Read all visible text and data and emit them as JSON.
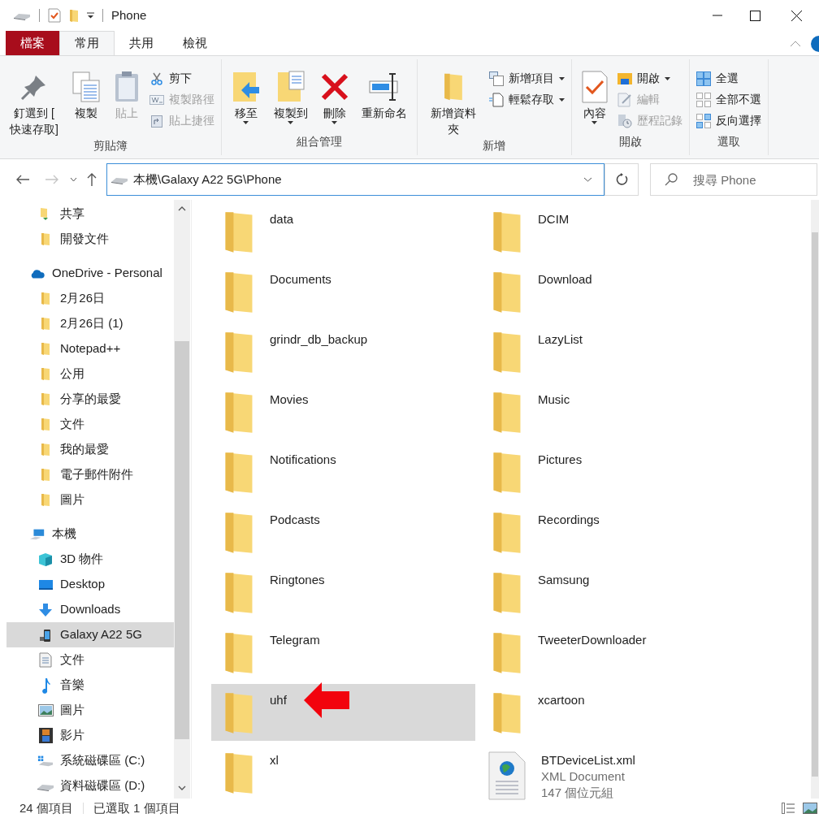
{
  "window": {
    "title": "Phone"
  },
  "tabs": [
    {
      "label": "檔案",
      "kind": "file",
      "selected": false
    },
    {
      "label": "常用",
      "kind": "tab",
      "selected": true
    },
    {
      "label": "共用",
      "kind": "tab",
      "selected": false
    },
    {
      "label": "檢視",
      "kind": "tab",
      "selected": false
    }
  ],
  "ribbon": {
    "groups": [
      {
        "label": "剪貼簿",
        "items": [
          {
            "kind": "large",
            "label": "釘選到 [\n快速存取]",
            "disabled": false,
            "dropdown": false
          },
          {
            "kind": "large",
            "label": "複製",
            "disabled": false,
            "dropdown": false
          },
          {
            "kind": "large",
            "label": "貼上",
            "disabled": true,
            "dropdown": false
          },
          {
            "kind": "small",
            "label": "剪下",
            "disabled": false,
            "dropdown": false
          },
          {
            "kind": "small",
            "label": "複製路徑",
            "disabled": true,
            "dropdown": false
          },
          {
            "kind": "small",
            "label": "貼上捷徑",
            "disabled": true,
            "dropdown": false
          }
        ]
      },
      {
        "label": "組合管理",
        "items": [
          {
            "kind": "large",
            "label": "移至",
            "disabled": false,
            "dropdown": true
          },
          {
            "kind": "large",
            "label": "複製到",
            "disabled": false,
            "dropdown": true
          },
          {
            "kind": "large",
            "label": "刪除",
            "disabled": false,
            "dropdown": true
          },
          {
            "kind": "large",
            "label": "重新命名",
            "disabled": false,
            "dropdown": false
          }
        ]
      },
      {
        "label": "新增",
        "items": [
          {
            "kind": "large",
            "label": "新增資料夾",
            "disabled": false,
            "dropdown": false
          },
          {
            "kind": "small",
            "label": "新增項目",
            "disabled": false,
            "dropdown": true
          },
          {
            "kind": "small",
            "label": "輕鬆存取",
            "disabled": false,
            "dropdown": true
          }
        ]
      },
      {
        "label": "開啟",
        "items": [
          {
            "kind": "large",
            "label": "內容",
            "disabled": false,
            "dropdown": true
          },
          {
            "kind": "small",
            "label": "開啟",
            "disabled": false,
            "dropdown": true
          },
          {
            "kind": "small",
            "label": "編輯",
            "disabled": true,
            "dropdown": false
          },
          {
            "kind": "small",
            "label": "歷程記錄",
            "disabled": true,
            "dropdown": false
          }
        ]
      },
      {
        "label": "選取",
        "items": [
          {
            "kind": "small",
            "label": "全選",
            "disabled": false,
            "dropdown": false
          },
          {
            "kind": "small",
            "label": "全部不選",
            "disabled": false,
            "dropdown": false
          },
          {
            "kind": "small",
            "label": "反向選擇",
            "disabled": false,
            "dropdown": false
          }
        ]
      }
    ]
  },
  "address_bar": {
    "path": "本機\\Galaxy A22 5G\\Phone"
  },
  "search": {
    "placeholder": "搜尋 Phone"
  },
  "navigation": {
    "items": [
      {
        "label": "共享",
        "kind": "shared",
        "selected": false
      },
      {
        "label": "開發文件",
        "kind": "folder",
        "selected": false
      }
    ],
    "sections": [
      {
        "label": "OneDrive - Personal",
        "kind": "cloud",
        "selected": false,
        "children": [
          {
            "label": "2月26日",
            "kind": "folder",
            "selected": false
          },
          {
            "label": "2月26日 (1)",
            "kind": "folder",
            "selected": false
          },
          {
            "label": "Notepad++",
            "kind": "folder",
            "selected": false
          },
          {
            "label": "公用",
            "kind": "folder",
            "selected": false
          },
          {
            "label": "分享的最愛",
            "kind": "folder",
            "selected": false
          },
          {
            "label": "文件",
            "kind": "folder",
            "selected": false
          },
          {
            "label": "我的最愛",
            "kind": "folder",
            "selected": false
          },
          {
            "label": "電子郵件附件",
            "kind": "folder",
            "selected": false
          },
          {
            "label": "圖片",
            "kind": "folder",
            "selected": false
          }
        ]
      },
      {
        "label": "本機",
        "kind": "pc",
        "selected": false,
        "children": [
          {
            "label": "3D 物件",
            "kind": "cube",
            "selected": false
          },
          {
            "label": "Desktop",
            "kind": "desktop",
            "selected": false
          },
          {
            "label": "Downloads",
            "kind": "download",
            "selected": false
          },
          {
            "label": "Galaxy A22 5G",
            "kind": "phone",
            "selected": true
          },
          {
            "label": "文件",
            "kind": "document",
            "selected": false
          },
          {
            "label": "音樂",
            "kind": "music",
            "selected": false
          },
          {
            "label": "圖片",
            "kind": "picture",
            "selected": false
          },
          {
            "label": "影片",
            "kind": "video",
            "selected": false
          },
          {
            "label": "系統磁碟區 (C:)",
            "kind": "system-drive",
            "selected": false
          },
          {
            "label": "資料磁碟區 (D:)",
            "kind": "drive",
            "selected": false
          }
        ]
      }
    ]
  },
  "files": [
    {
      "name": "data",
      "kind": "folder",
      "selected": false
    },
    {
      "name": "DCIM",
      "kind": "folder",
      "selected": false
    },
    {
      "name": "Documents",
      "kind": "folder",
      "selected": false
    },
    {
      "name": "Download",
      "kind": "folder",
      "selected": false
    },
    {
      "name": "grindr_db_backup",
      "kind": "folder",
      "selected": false
    },
    {
      "name": "LazyList",
      "kind": "folder",
      "selected": false
    },
    {
      "name": "Movies",
      "kind": "folder",
      "selected": false
    },
    {
      "name": "Music",
      "kind": "folder",
      "selected": false
    },
    {
      "name": "Notifications",
      "kind": "folder",
      "selected": false
    },
    {
      "name": "Pictures",
      "kind": "folder",
      "selected": false
    },
    {
      "name": "Podcasts",
      "kind": "folder",
      "selected": false
    },
    {
      "name": "Recordings",
      "kind": "folder",
      "selected": false
    },
    {
      "name": "Ringtones",
      "kind": "folder",
      "selected": false
    },
    {
      "name": "Samsung",
      "kind": "folder",
      "selected": false
    },
    {
      "name": "Telegram",
      "kind": "folder",
      "selected": false
    },
    {
      "name": "TweeterDownloader",
      "kind": "folder",
      "selected": false
    },
    {
      "name": "uhf",
      "kind": "folder",
      "selected": true
    },
    {
      "name": "xcartoon",
      "kind": "folder",
      "selected": false
    },
    {
      "name": "xl",
      "kind": "folder",
      "selected": false
    },
    {
      "name": "BTDeviceList.xml",
      "kind": "xml",
      "selected": false,
      "type": "XML Document",
      "size": "147 個位元組"
    }
  ],
  "status_bar": {
    "item_count": "24 個項目",
    "selection": "已選取 1 個項目"
  }
}
